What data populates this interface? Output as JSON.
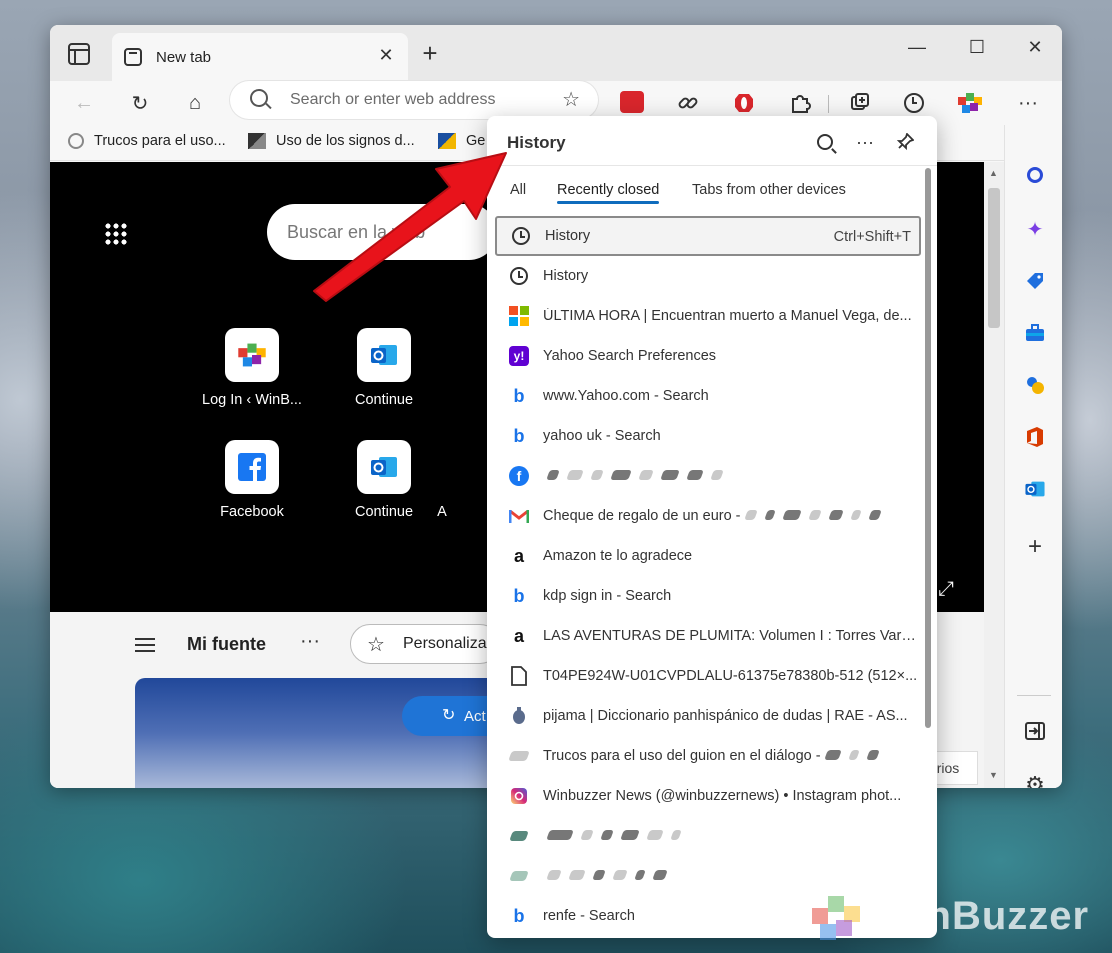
{
  "window": {
    "tab_title": "New tab",
    "tab_close": "✕",
    "new_tab": "+",
    "controls": {
      "minimize": "—",
      "maximize": "☐",
      "close": "✕"
    }
  },
  "toolbar": {
    "back": "←",
    "refresh": "↻",
    "home": "⌂",
    "address_placeholder": "Search or enter web address",
    "favorite": "☆",
    "more": "···"
  },
  "bookmarks": [
    {
      "label": "Trucos para el uso..."
    },
    {
      "label": "Uso de los signos d..."
    },
    {
      "label": "Ge"
    }
  ],
  "newtab": {
    "search_placeholder": "Buscar en la web",
    "tiles": [
      {
        "label": "Log In ‹ WinB..."
      },
      {
        "label": "Continue"
      },
      {
        "label": "Facebook"
      },
      {
        "label": "Continue"
      },
      {
        "label": "A"
      }
    ],
    "feed_title": "Mi fuente",
    "personalize": "Personaliza",
    "news_button": "Act",
    "side_button": "rios"
  },
  "history": {
    "title": "History",
    "tabs": [
      {
        "label": "All"
      },
      {
        "label": "Recently closed"
      },
      {
        "label": "Tabs from other devices"
      }
    ],
    "items": [
      {
        "title": "History",
        "shortcut": "Ctrl+Shift+T",
        "icon": "clock-icon"
      },
      {
        "title": "History",
        "icon": "clock-icon"
      },
      {
        "title": "ÚLTIMA HORA | Encuentran muerto a Manuel Vega, de...",
        "icon": "microsoft-icon"
      },
      {
        "title": "Yahoo Search Preferences",
        "icon": "yahoo-icon"
      },
      {
        "title": "www.Yahoo.com - Search",
        "icon": "bing-icon"
      },
      {
        "title": "yahoo uk - Search",
        "icon": "bing-icon"
      },
      {
        "title": "",
        "icon": "facebook-icon"
      },
      {
        "title": "Cheque de regalo de un euro -",
        "icon": "gmail-icon"
      },
      {
        "title": "Amazon te lo agradece",
        "icon": "amazon-icon"
      },
      {
        "title": "kdp sign in - Search",
        "icon": "bing-icon"
      },
      {
        "title": "LAS AVENTURAS DE PLUMITA: Volumen I : Torres Varg...",
        "icon": "amazon-icon"
      },
      {
        "title": "T04PE924W-U01CVPDLALU-61375e78380b-512 (512×...",
        "icon": "file-icon"
      },
      {
        "title": "pijama | Diccionario panhispánico de dudas | RAE - AS...",
        "icon": "rae-icon"
      },
      {
        "title": "Trucos para el uso del guion en el diálogo -",
        "icon": "site-icon"
      },
      {
        "title": "Winbuzzer News (@winbuzzernews) • Instagram phot...",
        "icon": "instagram-icon"
      },
      {
        "title": "",
        "icon": "site-icon"
      },
      {
        "title": "",
        "icon": "site-icon"
      },
      {
        "title": "renfe - Search",
        "icon": "bing-icon"
      }
    ]
  },
  "watermark": {
    "text": "WinBuzzer"
  },
  "colors": {
    "accent": "#0f6cbd",
    "arrow": "#e8131b"
  }
}
